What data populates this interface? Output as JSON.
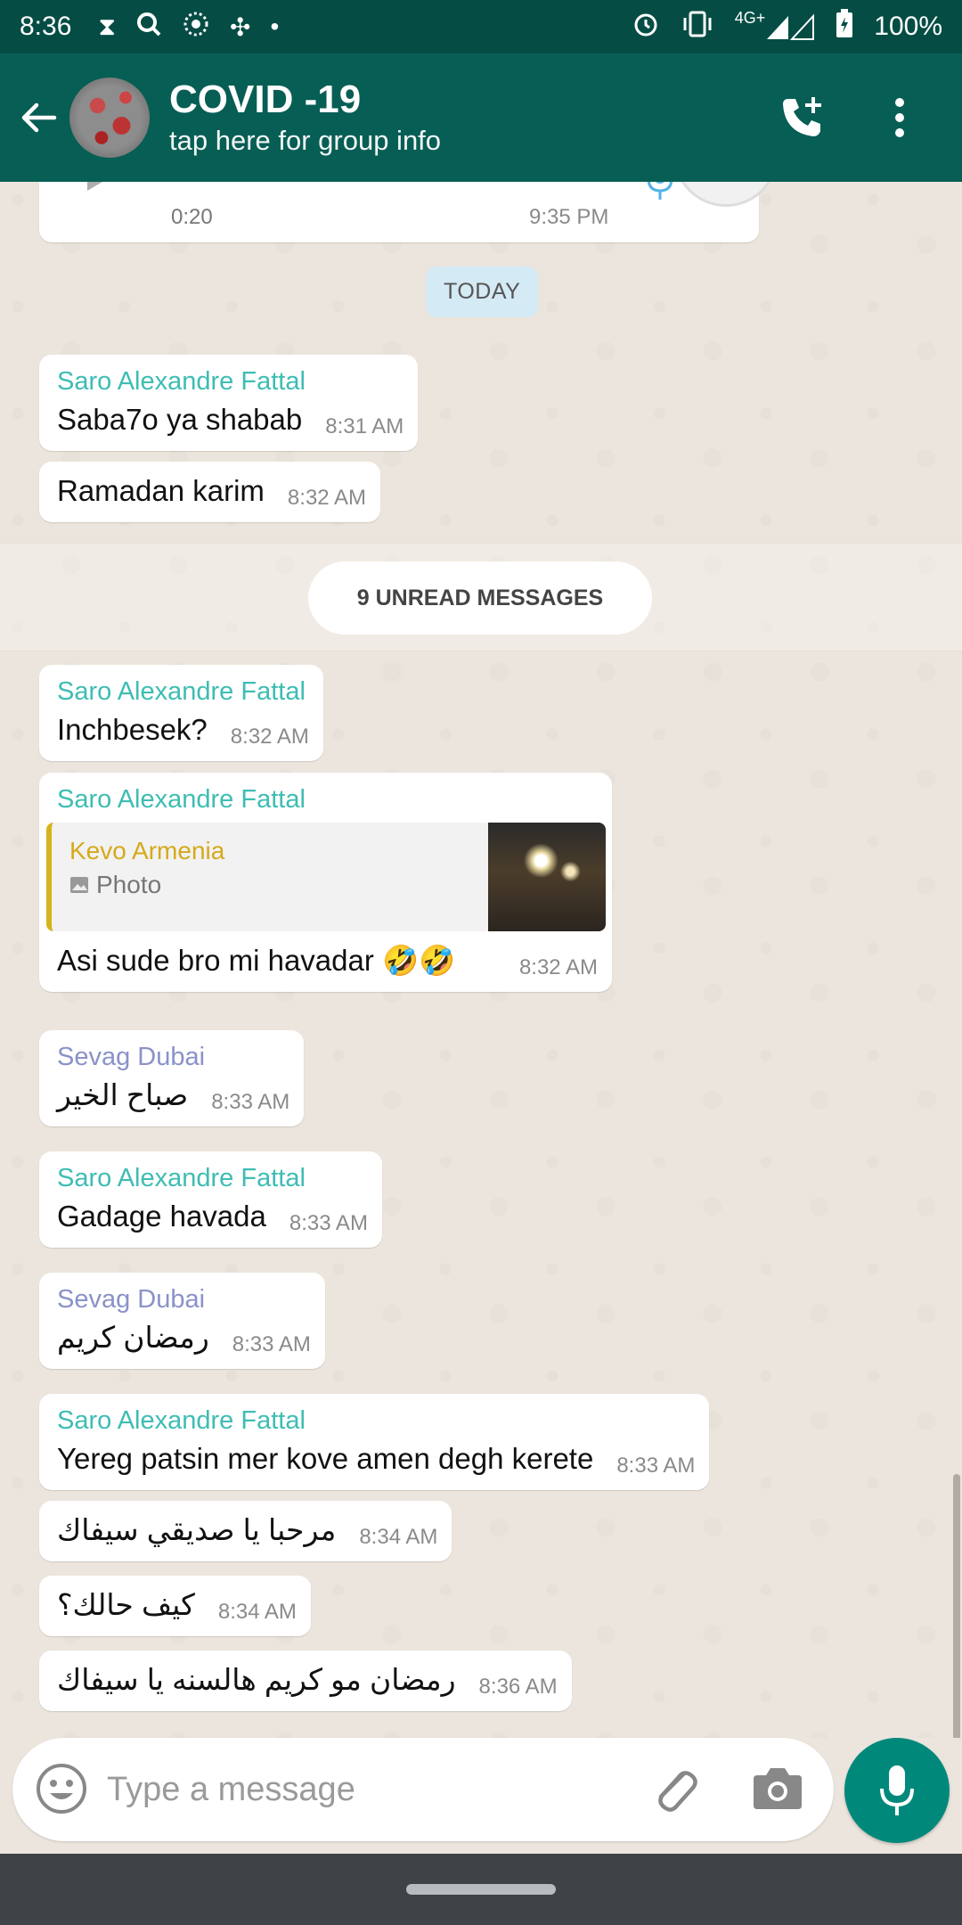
{
  "status_bar": {
    "time": "8:36",
    "network": "4G+",
    "battery": "100%"
  },
  "header": {
    "title": "COVID -19",
    "subtitle": "tap here for group info"
  },
  "audio_message": {
    "duration": "0:20",
    "time": "9:35 PM"
  },
  "date_chip": "TODAY",
  "unread_label": "9 UNREAD MESSAGES",
  "messages": [
    {
      "sender": "Saro Alexandre Fattal",
      "text": "Saba7o ya shabab",
      "time": "8:31 AM"
    },
    {
      "text": "Ramadan karim",
      "time": "8:32 AM"
    },
    {
      "sender": "Saro Alexandre Fattal",
      "text": "Inchbesek?",
      "time": "8:32 AM"
    },
    {
      "sender": "Saro Alexandre Fattal",
      "quote": {
        "name": "Kevo Armenia",
        "type": "Photo"
      },
      "text": "Asi sude bro mi havadar 🤣🤣",
      "time": "8:32 AM"
    },
    {
      "sender": "Sevag Dubai",
      "text": "صباح الخير",
      "time": "8:33 AM"
    },
    {
      "sender": "Saro Alexandre Fattal",
      "text": "Gadage havada",
      "time": "8:33 AM"
    },
    {
      "sender": "Sevag Dubai",
      "text": "رمضان كريم",
      "time": "8:33 AM"
    },
    {
      "sender": "Saro Alexandre Fattal",
      "text": "Yereg patsin mer kove amen degh kerete",
      "time": "8:33 AM"
    },
    {
      "text": "مرحبا يا صديقي سيفاك",
      "time": "8:34 AM"
    },
    {
      "text": "كيف حالك؟",
      "time": "8:34 AM"
    },
    {
      "text": "رمضان مو كريم هالسنه يا سيفاك",
      "time": "8:36 AM"
    }
  ],
  "composer": {
    "placeholder": "Type a message"
  },
  "colors": {
    "header": "#075e54",
    "status_bar": "#054d44",
    "accent": "#00897b",
    "sender_saro": "#3ebdb3",
    "sender_sevag": "#8a92c8",
    "quote_accent": "#d6b31a"
  },
  "icons": {
    "status_left": [
      "hourglass-icon",
      "search-icon",
      "dotted-circle-icon",
      "pinwheel-icon",
      "dot-icon"
    ],
    "status_right": [
      "alarm-icon",
      "vibrate-icon",
      "signal-icon",
      "battery-icon"
    ],
    "header": [
      "back-arrow-icon",
      "add-call-icon",
      "more-vert-icon"
    ],
    "composer": [
      "emoji-icon",
      "attach-icon",
      "camera-icon",
      "mic-icon"
    ]
  }
}
